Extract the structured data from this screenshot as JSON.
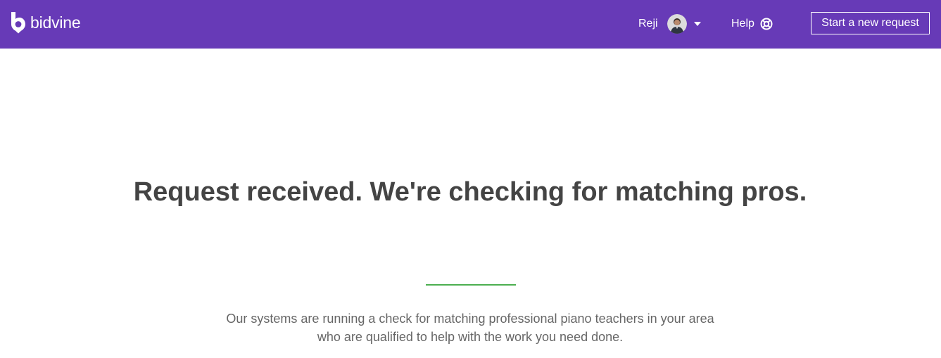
{
  "header": {
    "brand": "bidvine",
    "user_name": "Reji",
    "help_label": "Help",
    "new_request_label": "Start a new request",
    "icons": {
      "logo": "bidvine-logo-icon",
      "avatar": "user-avatar",
      "menu": "caret-down-icon",
      "help": "lifebuoy-icon"
    },
    "colors": {
      "background": "#673ab7",
      "text": "#ffffff"
    }
  },
  "main": {
    "headline": "Request received. We're checking for matching pros.",
    "description": "Our systems are running a check for matching professional piano teachers in your area who are qualified to help with the work you need done.",
    "colors": {
      "headline": "#444444",
      "description": "#666666",
      "divider": "#4caf50"
    }
  }
}
